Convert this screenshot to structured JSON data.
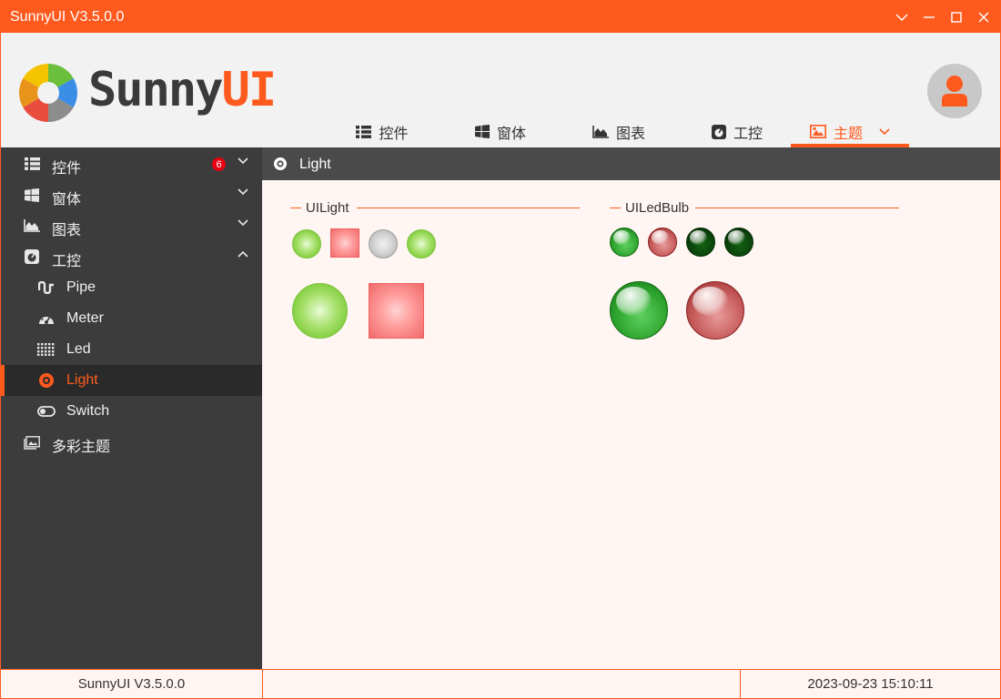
{
  "window": {
    "title": "SunnyUI V3.5.0.0"
  },
  "colors": {
    "accent": "#ff5a1e",
    "sidebar_bg": "#3c3c3c",
    "content_bg": "#fff5f2"
  },
  "header": {
    "logo": {
      "text_main": "Sunny",
      "text_accent": "UI"
    },
    "nav": [
      {
        "label": "控件",
        "icon": "list-icon"
      },
      {
        "label": "窗体",
        "icon": "windows-icon"
      },
      {
        "label": "图表",
        "icon": "area-chart-icon"
      },
      {
        "label": "工控",
        "icon": "gauge-icon"
      },
      {
        "label": "主题",
        "icon": "image-icon",
        "active": true
      }
    ]
  },
  "sidebar": {
    "items": [
      {
        "label": "控件",
        "icon": "list-icon",
        "badge": "6",
        "expanded": false
      },
      {
        "label": "窗体",
        "icon": "windows-icon",
        "expanded": false
      },
      {
        "label": "图表",
        "icon": "area-chart-icon",
        "expanded": false
      },
      {
        "label": "工控",
        "icon": "gauge-icon",
        "expanded": true
      },
      {
        "label": "Pipe",
        "icon": "pipe-icon",
        "sub": true
      },
      {
        "label": "Meter",
        "icon": "meter-icon",
        "sub": true
      },
      {
        "label": "Led",
        "icon": "led-grid-icon",
        "sub": true
      },
      {
        "label": "Light",
        "icon": "light-icon",
        "sub": true,
        "selected": true
      },
      {
        "label": "Switch",
        "icon": "toggle-icon",
        "sub": true
      },
      {
        "label": "多彩主题",
        "icon": "image-icon"
      }
    ]
  },
  "content": {
    "title": "Light",
    "groups": [
      {
        "title": "UILight"
      },
      {
        "title": "UILedBulb"
      }
    ]
  },
  "statusbar": {
    "left": "SunnyUI V3.5.0.0",
    "middle": "",
    "right": "2023-09-23 15:10:11"
  }
}
